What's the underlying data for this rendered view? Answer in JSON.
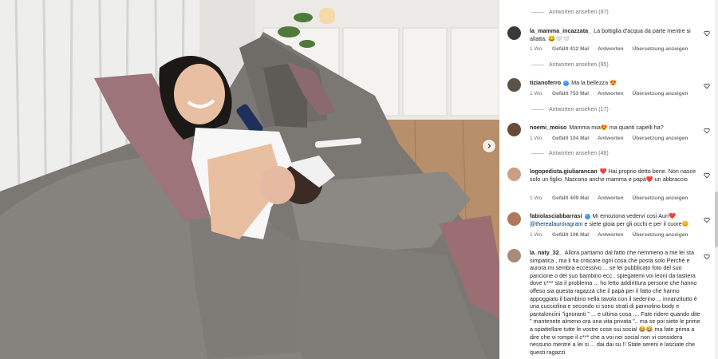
{
  "post": {
    "carousel_next_icon": "chevron-right-icon"
  },
  "comments": [
    {
      "type": "replies",
      "label": "Antworten ansehen (87)"
    },
    {
      "type": "comment",
      "username": "la_mamma_incazzata_",
      "verified": false,
      "text": "La bottiglia d'acqua da parte mentre si allatta. 😂🤍🤍",
      "age": "1 Wo.",
      "likes": "Gefällt 412 Mal",
      "reply": "Antworten",
      "translate": "Übersetzung anzeigen",
      "avatar_color": "#3a3a3a"
    },
    {
      "type": "replies",
      "label": "Antworten ansehen (95)"
    },
    {
      "type": "comment",
      "username": "tizianoferro",
      "verified": true,
      "text": "Ma la bellezza 😍",
      "age": "1 Wo.",
      "likes": "Gefällt 753 Mal",
      "reply": "Antworten",
      "translate": "Übersetzung anzeigen",
      "avatar_color": "#5b5348"
    },
    {
      "type": "replies",
      "label": "Antworten ansehen (17)"
    },
    {
      "type": "comment",
      "username": "noemi_moiso",
      "verified": false,
      "text": "Mamma mia😍 ma quanti capelli ha?",
      "age": "1 Wo.",
      "likes": "Gefällt 104 Mal",
      "reply": "Antworten",
      "translate": "Übersetzung anzeigen",
      "avatar_color": "#6b4a3a"
    },
    {
      "type": "replies",
      "label": "Antworten ansehen (48)"
    },
    {
      "type": "comment",
      "username": "logopedista.giuliarancan",
      "verified": false,
      "text": "❤️ Hai proprio detto bene. Non nasce solo un figlio. Nascono anche mamma e papà❤️ un abbraccio",
      "age": "1 Wo.",
      "likes": "Gefällt 409 Mal",
      "reply": "Antworten",
      "translate": "Übersetzung anzeigen",
      "avatar_color": "#c9a084"
    },
    {
      "type": "comment",
      "username": "fabiolasciabbarrasi",
      "verified": true,
      "text": "Mi emoziona vedervi così Auri❤️",
      "mention": "@therealauroragram",
      "text_after": "e siete gioia per gli occhi e per il cuore😊",
      "age": "1 Wo.",
      "likes": "Gefällt 108 Mal",
      "reply": "Antworten",
      "translate": "Übersetzung anzeigen",
      "avatar_color": "#b07a5a"
    },
    {
      "type": "comment",
      "username": "la_naty_32_",
      "verified": false,
      "text": "Allora partiamo dal fatto che nemmeno a me lei sta simpatica , ma li ha criticare ogni cosa che posta solo Perché e aurora mi sembra eccessivo ... se lei pubblicato foto del suo pancione o del suo bambino ecc.. spiegatemi voi leoni da tastiera dove c*** sta il problema ... ho letto addirittura persone che hanno offeso sia questa ragazza che il papà per il fatto che hanno appoggiato il bambino nella tavola con il sederino ... innanzitutto è una cucciolina e secondo ci sono strati di pannolino body e pantaloncini \"ignoranti \" ... e ultima cosa .... Fate ridere quando dite \" mantenete almeno ora una vita privata \".. ma se poi siete le prime a spiattellare tutte le vostre cose sui social 😂😂 ma fate prima a dire che vi rompe il c*** che a voi nei social non vi considera nessuno mentre a lei si ... dai dai su !! State sereni e lasciate che questi ragazzi",
      "avatar_color": "#a88c78"
    }
  ]
}
